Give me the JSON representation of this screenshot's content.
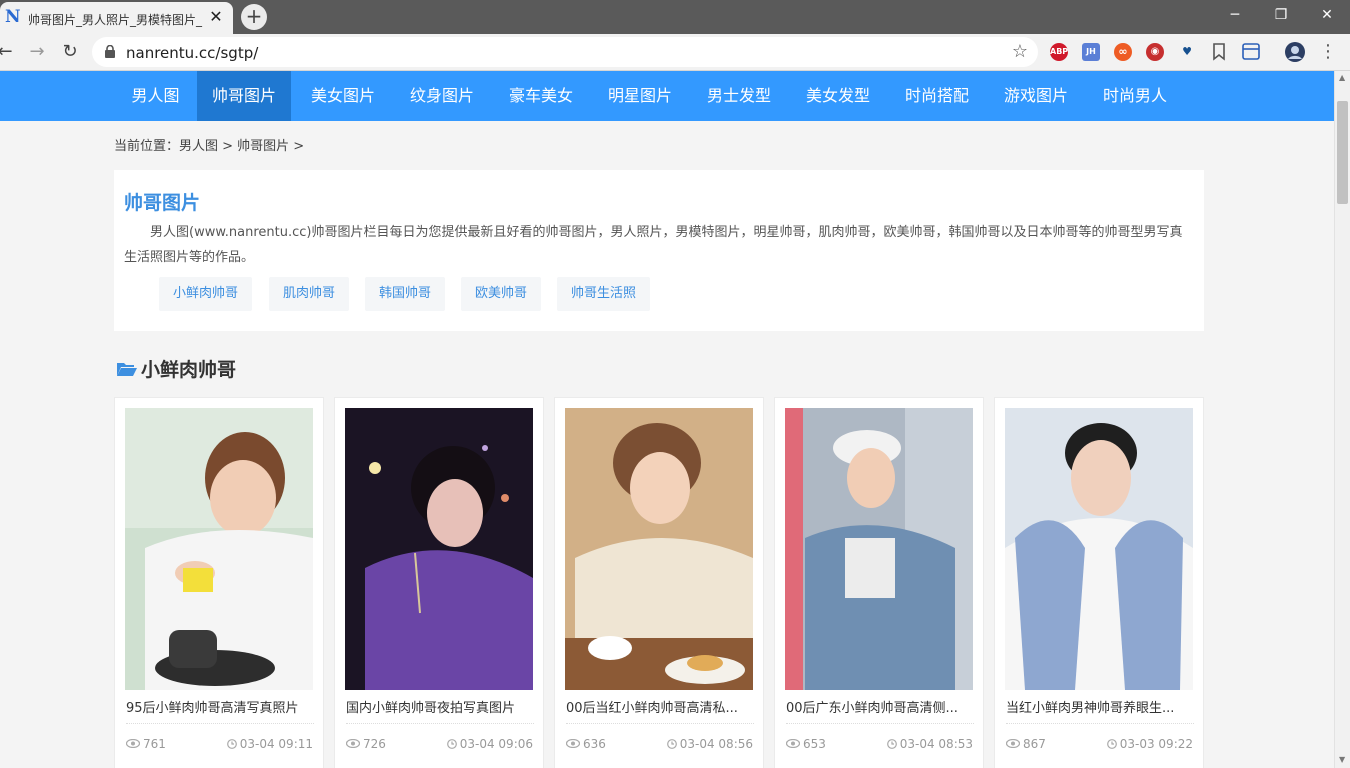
{
  "browser": {
    "tab_title": "帅哥图片_男人照片_男模特图片_",
    "url": "nanrentu.cc/sgtp/",
    "favicon_letter": "N",
    "extensions": [
      {
        "label": "ABP",
        "color": "#d0192b"
      },
      {
        "label": "JH",
        "color": "#5b7fd6"
      },
      {
        "label": "∞",
        "color": "#ee5c24"
      },
      {
        "label": "◉",
        "color": "#c62f2f"
      },
      {
        "label": "♥",
        "color": "#16508f"
      }
    ]
  },
  "nav": {
    "items": [
      {
        "label": "男人图"
      },
      {
        "label": "帅哥图片"
      },
      {
        "label": "美女图片"
      },
      {
        "label": "纹身图片"
      },
      {
        "label": "豪车美女"
      },
      {
        "label": "明星图片"
      },
      {
        "label": "男士发型"
      },
      {
        "label": "美女发型"
      },
      {
        "label": "时尚搭配"
      },
      {
        "label": "游戏图片"
      },
      {
        "label": "时尚男人"
      }
    ],
    "active_index": 1,
    "bg_color": "#3399ff"
  },
  "breadcrumb": {
    "text": "当前位置：男人图 > 帅哥图片 >"
  },
  "intro": {
    "title": "帅哥图片",
    "description": "男人图(www.nanrentu.cc)帅哥图片栏目每日为您提供最新且好看的帅哥图片，男人照片，男模特图片，明星帅哥，肌肉帅哥，欧美帅哥，韩国帅哥以及日本帅哥等的帅哥型男写真生活照图片等的作品。",
    "tags": [
      "小鲜肉帅哥",
      "肌肉帅哥",
      "韩国帅哥",
      "欧美帅哥",
      "帅哥生活照"
    ]
  },
  "section": {
    "title": "小鲜肉帅哥",
    "icon": "folder-open-icon"
  },
  "cards": [
    {
      "title": "95后小鲜肉帅哥高清写真照片",
      "views": "761",
      "date": "03-04 09:11"
    },
    {
      "title": "国内小鲜肉帅哥夜拍写真图片",
      "views": "726",
      "date": "03-04 09:06"
    },
    {
      "title": "00后当红小鲜肉帅哥高清私...",
      "views": "636",
      "date": "03-04 08:56"
    },
    {
      "title": "00后广东小鲜肉帅哥高清侧...",
      "views": "653",
      "date": "03-04 08:53"
    },
    {
      "title": "当红小鲜肉男神帅哥养眼生...",
      "views": "867",
      "date": "03-03 09:22"
    }
  ]
}
